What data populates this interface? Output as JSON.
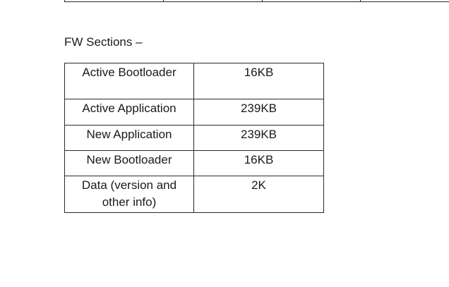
{
  "heading": "FW Sections –",
  "sections_table": {
    "rows": [
      {
        "section": "Active Bootloader",
        "size": "16KB"
      },
      {
        "section": "Active Application",
        "size": "239KB"
      },
      {
        "section": "New Application",
        "size": "239KB"
      },
      {
        "section": "New Bootloader",
        "size": "16KB"
      },
      {
        "section": "Data (version and other info)",
        "size": "2K"
      }
    ]
  }
}
